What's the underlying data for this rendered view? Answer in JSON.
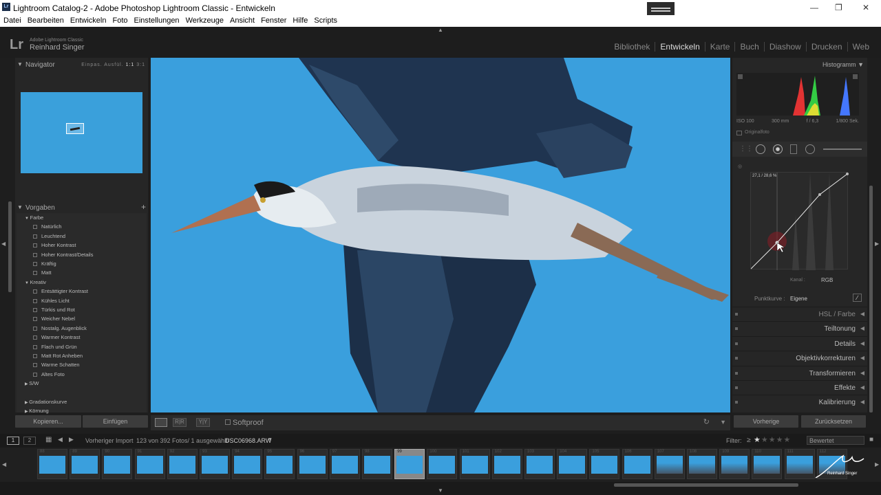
{
  "window": {
    "title": "Lightroom Catalog-2 - Adobe Photoshop Lightroom Classic - Entwickeln",
    "app_icon": "Lr"
  },
  "menu": [
    "Datei",
    "Bearbeiten",
    "Entwickeln",
    "Foto",
    "Einstellungen",
    "Werkzeuge",
    "Ansicht",
    "Fenster",
    "Hilfe",
    "Scripts"
  ],
  "identity": {
    "logo": "Lr",
    "line1": "Adobe Lightroom Classic",
    "line2": "Reinhard Singer"
  },
  "modules": [
    {
      "label": "Bibliothek",
      "active": false
    },
    {
      "label": "Entwickeln",
      "active": true
    },
    {
      "label": "Karte",
      "active": false
    },
    {
      "label": "Buch",
      "active": false
    },
    {
      "label": "Diashow",
      "active": false
    },
    {
      "label": "Drucken",
      "active": false
    },
    {
      "label": "Web",
      "active": false
    }
  ],
  "navigator": {
    "title": "Navigator",
    "zoom_options": [
      "Einpas.",
      "Ausfül.",
      "1:1",
      "3:1"
    ],
    "active_zoom": "1:1"
  },
  "presets": {
    "title": "Vorgaben",
    "groups": [
      {
        "label": "Farbe",
        "items": [
          "Natürlich",
          "Leuchtend",
          "Hoher Kontrast",
          "Hoher Kontrast/Details",
          "Kräftig",
          "Matt"
        ]
      },
      {
        "label": "Kreativ",
        "items": [
          "Entsättigter Kontrast",
          "Kühles Licht",
          "Türkis und Rot",
          "Weicher Nebel",
          "Nostalg. Augenblick",
          "Warmer Kontrast",
          "Flach und Grün",
          "Matt Rot Anheben",
          "Warme Schatten",
          "Altes Foto"
        ]
      }
    ],
    "collapsed": [
      "S/W",
      "Gradationskurve",
      "Körnung"
    ]
  },
  "left_buttons": {
    "copy": "Kopieren...",
    "paste": "Einfügen"
  },
  "toolbar": {
    "softproof": "Softproof"
  },
  "histogram": {
    "title": "Histogramm",
    "iso": "ISO 100",
    "focal": "300 mm",
    "aperture": "f / 6,3",
    "shutter": "1/800 Sek.",
    "original": "Originalfoto"
  },
  "curve": {
    "readout": "27,1 / 28,6 %",
    "channel_label": "Kanal :",
    "channel_value": "RGB",
    "point_curve_label": "Punktkurve :",
    "point_curve_value": "Eigene"
  },
  "sections": [
    "HSL / Farbe",
    "Teiltonung",
    "Details",
    "Objektivkorrekturen",
    "Transformieren",
    "Effekte",
    "Kalibrierung"
  ],
  "right_buttons": {
    "previous": "Vorherige",
    "reset": "Zurücksetzen"
  },
  "filmbar": {
    "page1": "1",
    "page2": "2",
    "source": "Vorheriger Import",
    "count": "123 von 392 Fotos/ 1 ausgewählt/",
    "filename": "DSC06968.ARW",
    "filter_label": "Filter:",
    "filter_op": "≥",
    "rating_stars": 1,
    "filter_value": "Bewertet"
  },
  "filmstrip": {
    "numbers": [
      "88",
      "89",
      "90",
      "91",
      "92",
      "93",
      "94",
      "95",
      "96",
      "97",
      "98",
      "99",
      "100",
      "101",
      "102",
      "103",
      "104",
      "105",
      "106",
      "107",
      "108",
      "109",
      "110",
      "111",
      "112"
    ],
    "selected": "99"
  },
  "watermark": "Reinhard Singer",
  "colors": {
    "sky": "#3a9fdd",
    "panel": "#262626",
    "accent": "#ddd"
  }
}
